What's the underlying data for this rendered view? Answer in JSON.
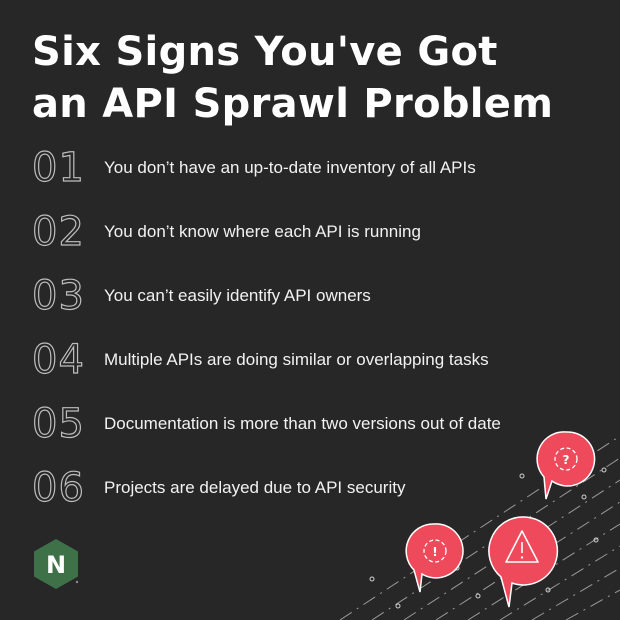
{
  "title": {
    "line1": "Six Signs You've Got",
    "line2": "an API Sprawl Problem"
  },
  "signs": [
    {
      "number": "01",
      "text": "You don’t have an up-to-date inventory of all APIs"
    },
    {
      "number": "02",
      "text": "You don’t know where each API is running"
    },
    {
      "number": "03",
      "text": "You can’t easily identify API owners"
    },
    {
      "number": "04",
      "text": "Multiple APIs are doing similar or overlapping tasks"
    },
    {
      "number": "05",
      "text": "Documentation is more than two versions out of date"
    },
    {
      "number": "06",
      "text": "Projects are delayed due to API security"
    }
  ],
  "logo": {
    "letter": "N",
    "icon": "nginx-hexagon-logo",
    "color": "#3f7148"
  },
  "illustration": {
    "icons": [
      "gear-alert-bubble-icon",
      "gear-alert-bubble-icon",
      "warning-triangle-bubble-icon"
    ],
    "accent": "#ee4a5b"
  },
  "colors": {
    "background": "#272727",
    "title": "#ffffff",
    "text": "#f2f2f2",
    "number_outline": "#bdbdbd"
  }
}
